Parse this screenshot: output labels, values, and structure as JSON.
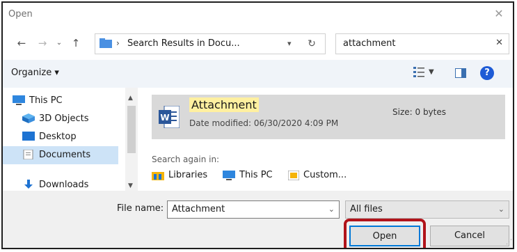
{
  "window": {
    "title": "Open"
  },
  "nav": {
    "path_separator": "›",
    "path": "Search Results in Docu...",
    "search_value": "attachment"
  },
  "toolbar": {
    "organize_label": "Organize ▾"
  },
  "sidebar": {
    "items": [
      {
        "label": "This PC",
        "icon": "this-pc-icon"
      },
      {
        "label": "3D Objects",
        "icon": "3d-objects-icon"
      },
      {
        "label": "Desktop",
        "icon": "desktop-icon"
      },
      {
        "label": "Documents",
        "icon": "documents-icon",
        "selected": true
      },
      {
        "label": "Downloads",
        "icon": "downloads-icon"
      }
    ]
  },
  "results": {
    "items": [
      {
        "name": "Attachment",
        "date_modified": "Date modified: 06/30/2020 4:09 PM",
        "size": "Size: 0 bytes",
        "icon": "word-document-icon"
      }
    ],
    "search_again_label": "Search again in:",
    "search_again_links": [
      {
        "label": "Libraries",
        "icon": "libraries-icon"
      },
      {
        "label": "This PC",
        "icon": "this-pc-icon"
      },
      {
        "label": "Custom...",
        "icon": "custom-icon"
      }
    ]
  },
  "bottom": {
    "file_name_label": "File name:",
    "file_name_value": "Attachment",
    "file_type_value": "All files",
    "open_label": "Open",
    "cancel_label": "Cancel"
  },
  "colors": {
    "accent": "#0078d7",
    "highlight_ring": "#b1141b",
    "search_highlight": "#fff0a0",
    "selected_row": "#d9d9d9"
  }
}
